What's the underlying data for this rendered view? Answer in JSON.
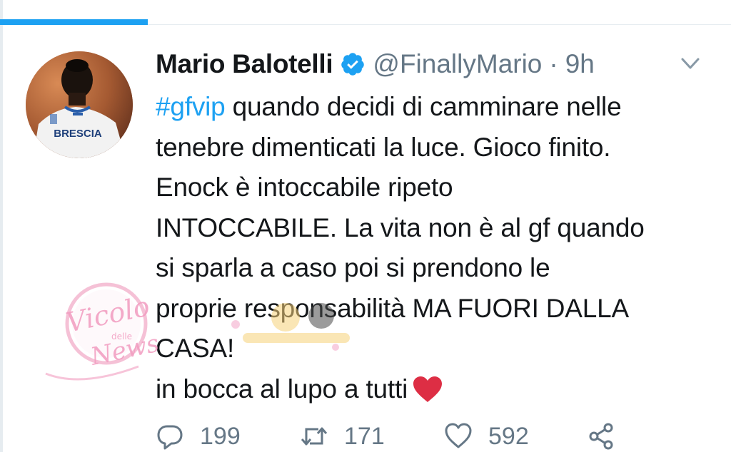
{
  "tweet": {
    "author_name": "Mario Balotelli",
    "handle": "@FinallyMario",
    "separator": "·",
    "time": "9h",
    "avatar_jersey_text": "BRESCIA",
    "lines": [
      {
        "hashtag": "#gfvip",
        "text": " quando decidi di camminare nelle"
      },
      {
        "text": "tenebre dimenticati la luce. Gioco finito."
      },
      {
        "text": "Enock è intoccabile ripeto"
      },
      {
        "text": "INTOCCABILE. La vita non è al gf quando"
      },
      {
        "text": "si sparla a caso poi si prendono le"
      },
      {
        "text": "proprie responsabilità MA FUORI DALLA"
      },
      {
        "text": "CASA!"
      },
      {
        "text": "in bocca al lupo a tutti"
      }
    ]
  },
  "actions": {
    "reply_count": "199",
    "retweet_count": "171",
    "like_count": "592"
  },
  "watermark": {
    "line1": "Vicolo",
    "line2": "delle",
    "line3": "News"
  },
  "colors": {
    "accent": "#1da1f2",
    "text": "#14171a",
    "secondary": "#657786",
    "heart": "#e0245e"
  },
  "icons": {
    "verified": "verified-badge-icon",
    "chevron": "chevron-down-icon",
    "reply": "reply-icon",
    "retweet": "retweet-icon",
    "like": "like-icon",
    "share": "share-icon",
    "heart": "red-heart-emoji-icon"
  }
}
